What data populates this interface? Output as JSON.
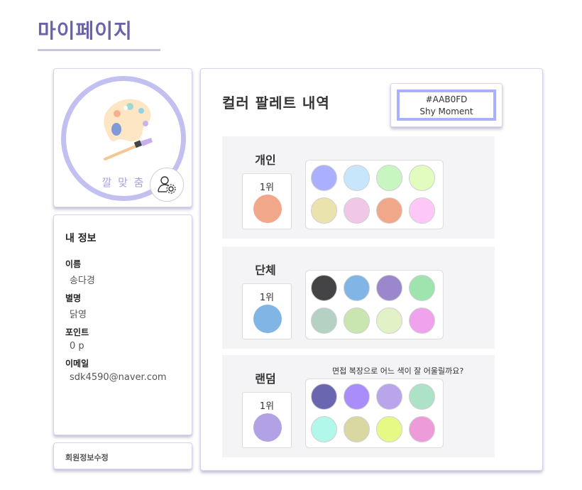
{
  "page": {
    "title": "마이페이지"
  },
  "profile": {
    "avatar_caption": "깔 맞 춤",
    "settings_icon": "user-gear-icon",
    "palette_icon": "paint-palette-icon"
  },
  "info": {
    "heading": "내 정보",
    "name_label": "이름",
    "name_value": "송다경",
    "nickname_label": "별명",
    "nickname_value": "닭영",
    "points_label": "포인트",
    "points_value": "0 p",
    "email_label": "이메일",
    "email_value": "sdk4590@naver.com",
    "edit_label": "회원정보수정"
  },
  "main": {
    "title": "컬러 팔레트 내역",
    "badge": {
      "hex": "#AAB0FD",
      "name": "Shy Moment",
      "color": "#aab0fd"
    }
  },
  "sections": [
    {
      "label": "개인",
      "question": "",
      "rank_label": "1위",
      "rank_color": "#f1a88a",
      "swatches": [
        "#aab0fd",
        "#c8e6fb",
        "#c7f6c1",
        "#e2fbbe",
        "#ebe3ae",
        "#f1c7e8",
        "#f1a88a",
        "#fdc8f8"
      ]
    },
    {
      "label": "단체",
      "question": "",
      "rank_label": "1위",
      "rank_color": "#80b5e5",
      "swatches": [
        "#444446",
        "#80b5e5",
        "#9a87cc",
        "#9fe3af",
        "#b5d1c3",
        "#c9e6b1",
        "#e2f1c6",
        "#f0a3ec"
      ]
    },
    {
      "label": "랜덤",
      "question": "면접 복장으로 어느 색이 잘 어울릴까요?",
      "rank_label": "1위",
      "rank_color": "#b3a1e5",
      "swatches": [
        "#6b66b0",
        "#a98efb",
        "#b9a5e9",
        "#ade2c7",
        "#b2f8ea",
        "#d9d7a2",
        "#e7f985",
        "#ed9bd9"
      ]
    }
  ]
}
